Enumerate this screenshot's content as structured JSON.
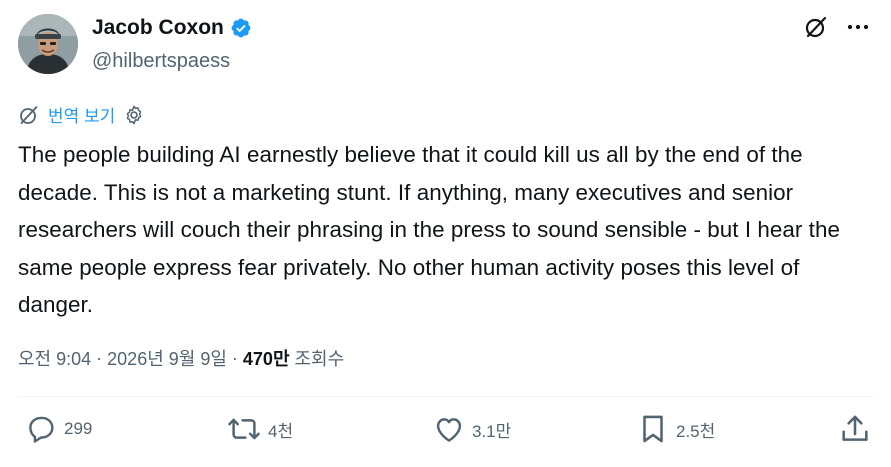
{
  "author": {
    "name": "Jacob Coxon",
    "handle": "@hilbertspaess"
  },
  "translate": {
    "label": "번역 보기"
  },
  "post": {
    "text": "The people building AI earnestly believe that it could kill us all by the end of the decade. This is not a marketing stunt. If anything, many executives and senior researchers will couch their phrasing in the press to sound sensible - but I hear the same people express fear privately. No other human activity poses this level of danger."
  },
  "meta": {
    "time": "오전 9:04",
    "separator": " · ",
    "date": "2026년 9월 9일",
    "views_count": "470만",
    "views_label": " 조회수"
  },
  "actions": {
    "replies": "299",
    "reposts": "4천",
    "likes": "3.1만",
    "bookmarks": "2.5천"
  },
  "colors": {
    "accent": "#1d9bf0",
    "secondary_text": "#536471",
    "primary_text": "#0f1419"
  },
  "icons": {
    "grok": "grok-icon",
    "more": "more-icon",
    "verified": "verified-badge-icon",
    "translate": "translate-icon",
    "settings": "gear-icon",
    "reply": "reply-icon",
    "repost": "repost-icon",
    "like": "heart-icon",
    "bookmark": "bookmark-icon",
    "share": "share-icon"
  }
}
